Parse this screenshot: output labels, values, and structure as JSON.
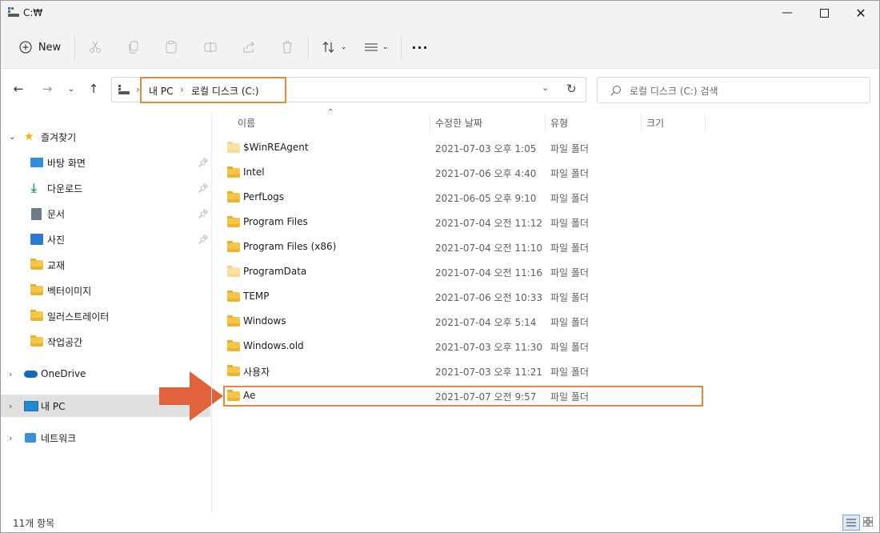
{
  "window": {
    "title": "C:₩"
  },
  "toolbar": {
    "new_label": "New",
    "buttons": [
      "cut-icon",
      "copy-icon",
      "paste-icon",
      "rename-icon",
      "share-icon",
      "delete-icon",
      "sort-icon",
      "view-icon",
      "more-icon"
    ]
  },
  "address": {
    "crumbs": [
      "내 PC",
      "로컬 디스크 (C:)"
    ],
    "search_placeholder": "로컬 디스크 (C:) 검색"
  },
  "sidebar": {
    "quick_access": "즐겨찾기",
    "pinned": [
      {
        "label": "바탕 화면",
        "icon": "desktop-icon"
      },
      {
        "label": "다운로드",
        "icon": "download-icon"
      },
      {
        "label": "문서",
        "icon": "document-icon"
      },
      {
        "label": "사진",
        "icon": "pictures-icon"
      }
    ],
    "folders": [
      {
        "label": "교재"
      },
      {
        "label": "벡터이미지"
      },
      {
        "label": "일러스트레이터"
      },
      {
        "label": "작업공간"
      }
    ],
    "onedrive": "OneDrive",
    "thispc": "내 PC",
    "network": "네트워크"
  },
  "columns": {
    "name": "이름",
    "date": "수정한 날짜",
    "type": "유형",
    "size": "크기"
  },
  "files": [
    {
      "name": "$WinREAgent",
      "date": "2021-07-03 오후 1:05",
      "type": "파일 폴더",
      "faded": true
    },
    {
      "name": "Intel",
      "date": "2021-07-06 오후 4:40",
      "type": "파일 폴더",
      "faded": false
    },
    {
      "name": "PerfLogs",
      "date": "2021-06-05 오후 9:10",
      "type": "파일 폴더",
      "faded": false
    },
    {
      "name": "Program Files",
      "date": "2021-07-04 오전 11:12",
      "type": "파일 폴더",
      "faded": false
    },
    {
      "name": "Program Files (x86)",
      "date": "2021-07-04 오전 11:10",
      "type": "파일 폴더",
      "faded": false
    },
    {
      "name": "ProgramData",
      "date": "2021-07-04 오전 11:16",
      "type": "파일 폴더",
      "faded": true
    },
    {
      "name": "TEMP",
      "date": "2021-07-06 오전 10:33",
      "type": "파일 폴더",
      "faded": false
    },
    {
      "name": "Windows",
      "date": "2021-07-04 오후 5:14",
      "type": "파일 폴더",
      "faded": false
    },
    {
      "name": "Windows.old",
      "date": "2021-07-03 오후 11:30",
      "type": "파일 폴더",
      "faded": false
    },
    {
      "name": "사용자",
      "date": "2021-07-03 오후 11:21",
      "type": "파일 폴더",
      "faded": false
    },
    {
      "name": "Ae",
      "date": "2021-07-07 오전 9:57",
      "type": "파일 폴더",
      "faded": false
    }
  ],
  "status": {
    "count": "11개 항목"
  },
  "colors": {
    "highlight": "#e8893a",
    "arrow": "#e0613a",
    "selected_nav": "#e0e0e0",
    "folder": "#f6c648"
  }
}
